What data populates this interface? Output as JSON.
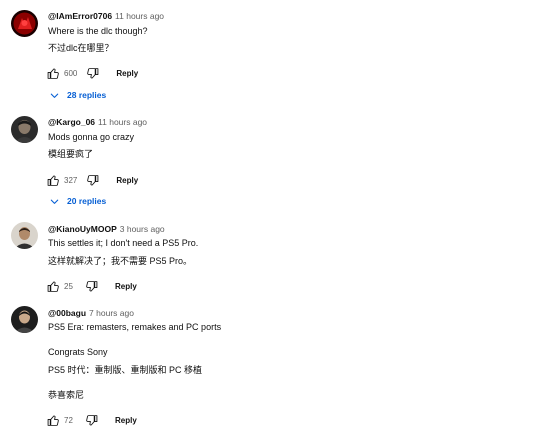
{
  "comments": [
    {
      "author": "@IAmError0706",
      "time": "11 hours ago",
      "lines": [
        "Where is the dlc though?",
        "不过dlc在哪里？"
      ],
      "likes": "600",
      "reply_label": "Reply",
      "replies_label": "28 replies"
    },
    {
      "author": "@Kargo_06",
      "time": "11 hours ago",
      "lines": [
        "Mods gonna go crazy",
        "模组要疯了"
      ],
      "likes": "327",
      "reply_label": "Reply",
      "replies_label": "20 replies"
    },
    {
      "author": "@KianoUyMOOP",
      "time": "3 hours ago",
      "lines": [
        "This settles it; I don't need a PS5 Pro.",
        "这样就解决了；我不需要 PS5 Pro。"
      ],
      "likes": "25",
      "reply_label": "Reply"
    },
    {
      "author": "@00bagu",
      "time": "7 hours ago",
      "lines": [
        "PS5 Era: remasters, remakes and PC ports",
        "Congrats Sony",
        "PS5 时代：重制版、重制版和 PC 移植",
        "恭喜索尼"
      ],
      "likes": "72",
      "reply_label": "Reply"
    }
  ],
  "icons": {
    "like": "thumbs-up-icon",
    "dislike": "thumbs-down-icon",
    "expand": "chevron-down-icon"
  },
  "colors": {
    "link_blue": "#065fd4",
    "secondary_text": "#606060",
    "primary_text": "#0f0f0f"
  }
}
